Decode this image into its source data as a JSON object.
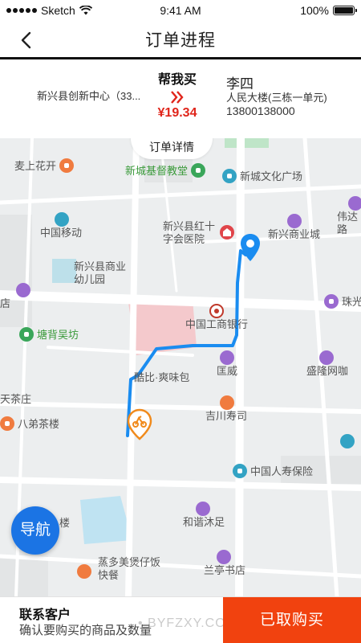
{
  "status_bar": {
    "carrier": "Sketch",
    "time": "9:41 AM",
    "battery": "100%",
    "battery_level": 1.0
  },
  "header": {
    "title": "订单进程"
  },
  "order": {
    "from_address": "新兴县创新中心（33...",
    "service_label": "帮我买",
    "price": "¥19.34",
    "receiver_name": "李四",
    "receiver_address": "人民大楼(三栋一单元)",
    "receiver_phone": "13800138000"
  },
  "map": {
    "detail_tab": "订单详情",
    "nav_button": "导航",
    "route_color": "#1a8cf0",
    "pois": {
      "maishanghuakai": "麦上花开",
      "xincheng_church": "新城基督教堂",
      "xincheng_plaza": "新城文化广场",
      "weidalu": "伟达路",
      "china_mobile": "中国移动",
      "redcross_line1": "新兴县红十",
      "redcross_line2": "字会医院",
      "xinxing_mall": "新兴商业城",
      "kindergarten_line1": "新兴县商业",
      "kindergarten_line2": "幼儿园",
      "shop_partial": "店",
      "zhuguang": "珠光",
      "tangbei": "塘背吴坊",
      "icbc": "中国工商银行",
      "tianchazhuang": "天茶庄",
      "kubi": "酷比·爽味包",
      "jiangwei": "匡威",
      "shenglong": "盛隆网咖",
      "babrothers": "八弟茶楼",
      "yoshikawa": "吉川寿司",
      "china_life": "中国人寿保险",
      "lou": "楼",
      "hexie": "和谐沐足",
      "burger_line1": "蒸多美煲仔饭",
      "burger_line2": "快餐",
      "lanting": "兰亭书店"
    }
  },
  "bottom": {
    "contact_title": "联系客户",
    "contact_subtitle": "确认要购买的商品及数量",
    "action_button": "已取购买",
    "watermark": "• BYFZXY.COM"
  },
  "colors": {
    "accent": "#f1420f",
    "price": "#e0251b",
    "nav_button": "#1b74e4"
  }
}
